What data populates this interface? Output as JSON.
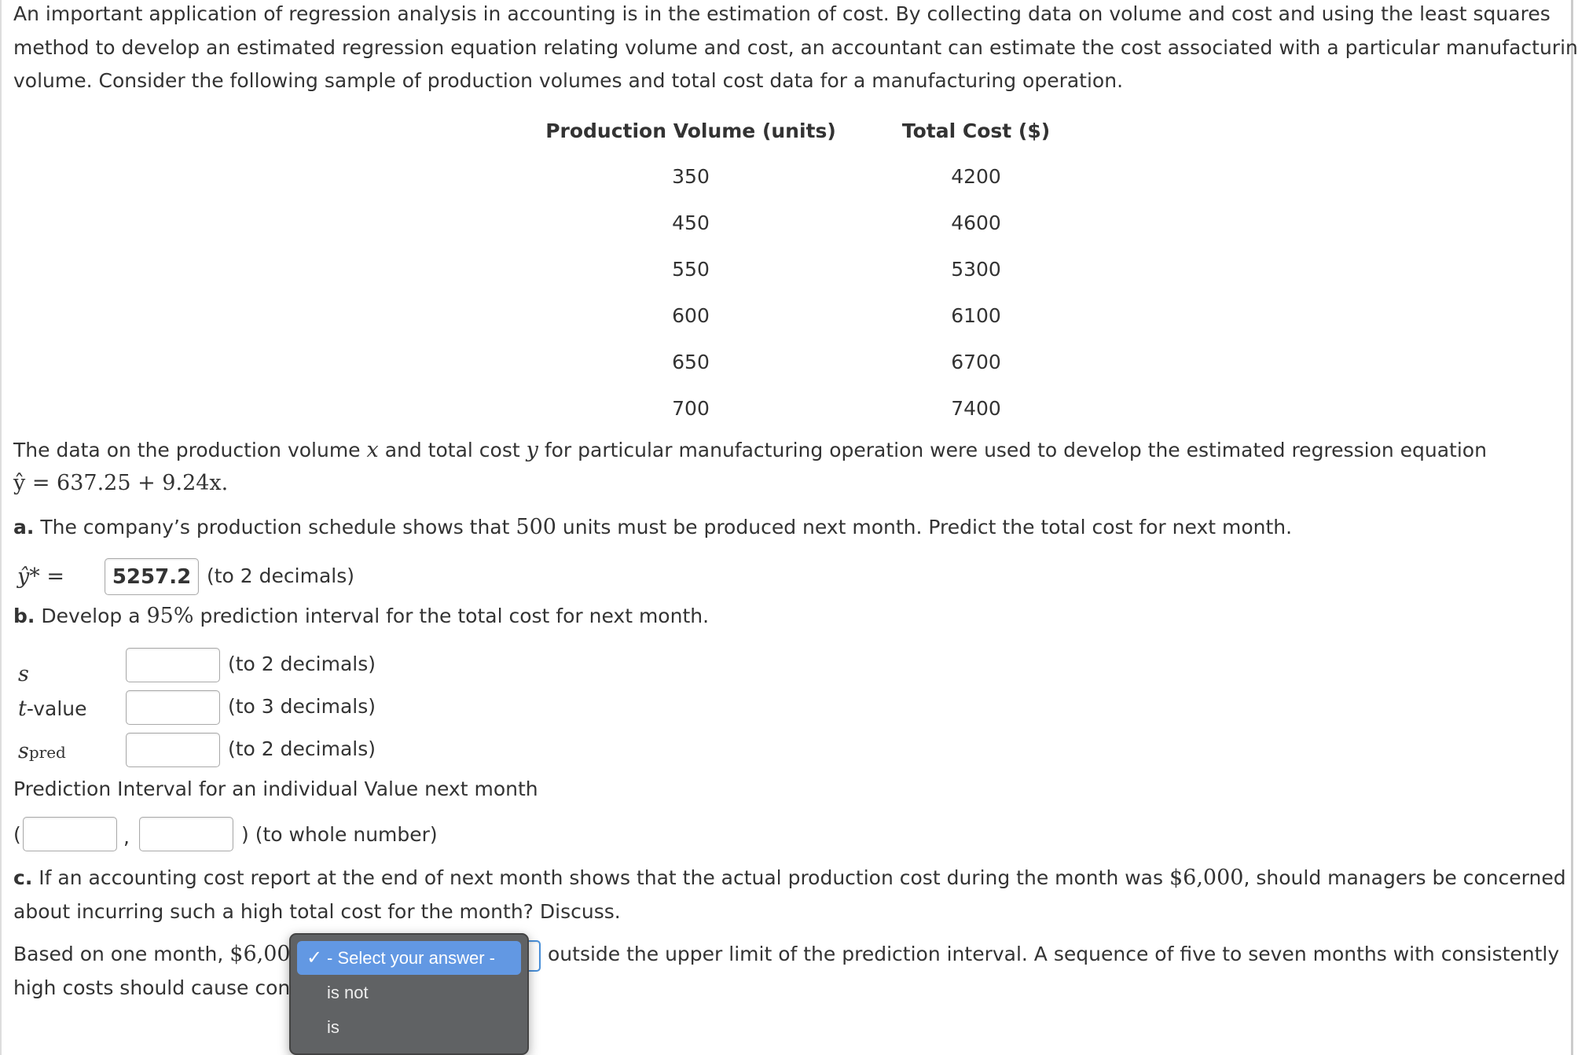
{
  "intro": [
    "An important application of regression analysis in accounting is in the estimation of cost. By collecting data on volume and cost and using the least squares",
    "method to develop an estimated regression equation relating volume and cost, an accountant can estimate the cost associated with a particular manufacturing",
    "volume. Consider the following sample of production volumes and total cost data for a manufacturing operation."
  ],
  "table": {
    "headers": [
      "Production Volume (units)",
      "Total Cost ($)"
    ],
    "rows": [
      [
        "350",
        "4200"
      ],
      [
        "450",
        "4600"
      ],
      [
        "550",
        "5300"
      ],
      [
        "600",
        "6100"
      ],
      [
        "650",
        "6700"
      ],
      [
        "700",
        "7400"
      ]
    ]
  },
  "data_text": {
    "pre": "The data on the production volume ",
    "x": "x",
    "mid": " and total cost ",
    "y": "y",
    "post": " for particular manufacturing operation were used to develop the estimated regression equation",
    "equation": "ŷ = 637.25 + 9.24x."
  },
  "part_a": {
    "label": "a.",
    "pre": " The company’s production schedule shows that ",
    "num": "500",
    "post": " units must be produced next month. Predict the total cost for next month.",
    "yhat_label": "ŷ* =",
    "answer": "5257.2",
    "hint": "(to 2 decimals)"
  },
  "part_b": {
    "label": "b.",
    "pre": " Develop a ",
    "pct": "95%",
    "post": " prediction interval for the total cost for next month.",
    "fields": [
      {
        "label": "s",
        "sub": "",
        "value": "",
        "hint": "(to 2 decimals)"
      },
      {
        "label": "t",
        "suffix": "-value",
        "value": "",
        "hint": "(to 3 decimals)"
      },
      {
        "label": "s",
        "sub": "pred",
        "value": "",
        "hint": "(to 2 decimals)"
      }
    ],
    "interval_title": "Prediction Interval for an individual Value next month",
    "open": "(",
    "comma": ",",
    "close": ") (to whole number)",
    "lower": "",
    "upper": ""
  },
  "part_c": {
    "label": "c.",
    "line1_pre": " If an accounting cost report at the end of next month shows that the actual production cost during the month was ",
    "amount": "$6,000",
    "line1_post": ", should managers be concerned",
    "line2": "about incurring such a high total cost for the month? Discuss.",
    "ans_pre": "Based on one month, ",
    "ans_amount": "$6,000",
    "ans_post": "outside the upper limit of the prediction interval. A sequence of five to seven months with consistently",
    "ans_line2": "high costs should cause conc"
  },
  "dropdown": {
    "options": [
      "- Select your answer -",
      "is not",
      "is"
    ],
    "selected": "- Select your answer -",
    "highlight": "#6298e3"
  }
}
